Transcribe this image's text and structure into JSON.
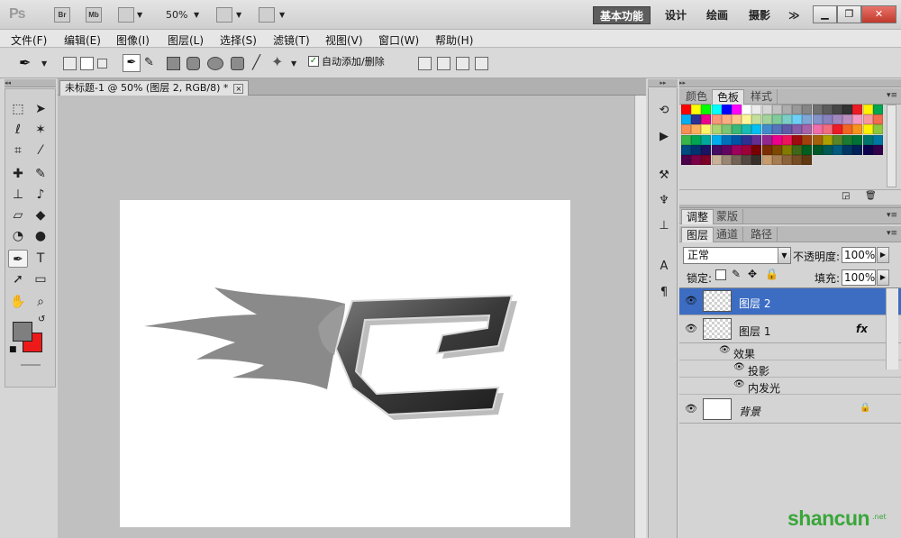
{
  "app": {
    "logo": "Ps",
    "bridge_btn": "Br",
    "minibridge_btn": "Mb",
    "zoom": "50%",
    "workspaces": [
      "基本功能",
      "设计",
      "绘画",
      "摄影"
    ],
    "more_label": "≫"
  },
  "menu": [
    "文件(F)",
    "编辑(E)",
    "图像(I)",
    "图层(L)",
    "选择(S)",
    "滤镜(T)",
    "视图(V)",
    "窗口(W)",
    "帮助(H)"
  ],
  "options": {
    "auto_add_delete": "自动添加/删除",
    "auto_add_checked": "✓"
  },
  "document": {
    "tab_title": "未标题-1 @ 50% (图层 2, RGB/8) *",
    "close": "×",
    "canvas_bg": "#ffffff",
    "fg_color": "#7f7f7f",
    "bg_color": "#ee1a1a"
  },
  "swatches_panel": {
    "tabs": [
      "颜色",
      "色板",
      "样式"
    ],
    "active_tab": "色板",
    "colors": [
      "#ff0000",
      "#ffff00",
      "#00ff00",
      "#00ffff",
      "#0000ff",
      "#ff00ff",
      "#ffffff",
      "#ebebeb",
      "#d6d6d6",
      "#c2c2c2",
      "#adadad",
      "#999999",
      "#858585",
      "#707070",
      "#5c5c5c",
      "#474747",
      "#333333",
      "#ed1c24",
      "#fff200",
      "#00a651",
      "#00aeef",
      "#2e3192",
      "#ec008c",
      "#f7977a",
      "#f9ad81",
      "#fdc68a",
      "#fff79a",
      "#c4df9b",
      "#a2d39c",
      "#82ca9d",
      "#7bcdc8",
      "#6ecff6",
      "#7ea7d8",
      "#8493ca",
      "#8882be",
      "#a187be",
      "#bc8dbf",
      "#f49ac2",
      "#f6989d",
      "#f26c4f",
      "#f68e55",
      "#fbaf5c",
      "#fff467",
      "#acd372",
      "#7cc576",
      "#3bb878",
      "#1abbb4",
      "#00bff3",
      "#438ccb",
      "#5574b9",
      "#605ca8",
      "#855fa8",
      "#a763a8",
      "#f06ea9",
      "#f26d7d",
      "#ed1c24",
      "#f26522",
      "#f7941d",
      "#fff200",
      "#8dc73f",
      "#39b54a",
      "#00a651",
      "#00a99d",
      "#00aeef",
      "#0072bc",
      "#0054a6",
      "#2e3192",
      "#662d91",
      "#92278f",
      "#ec008c",
      "#ed145b",
      "#9e0b0f",
      "#a0410d",
      "#a36209",
      "#aba000",
      "#598527",
      "#1a7b30",
      "#007236",
      "#00746b",
      "#0076a3",
      "#004b80",
      "#003471",
      "#1b1464",
      "#440e62",
      "#630460",
      "#9e005d",
      "#9e0039",
      "#790000",
      "#7b2e00",
      "#7d4900",
      "#827b00",
      "#406618",
      "#005e20",
      "#005826",
      "#005952",
      "#005b7f",
      "#003663",
      "#002157",
      "#0d004c",
      "#32004b",
      "#4b0049",
      "#7b0046",
      "#7a0026",
      "#c7b299",
      "#998675",
      "#736357",
      "#534741",
      "#37302a",
      "#c69c6d",
      "#a67c52",
      "#8c6239",
      "#754c24",
      "#603913"
    ]
  },
  "adjust_panel": {
    "tabs": [
      "调整",
      "蒙版"
    ],
    "active_tab": "调整"
  },
  "layers_panel": {
    "tabs": [
      "图层",
      "通道",
      "路径"
    ],
    "active_tab": "图层",
    "blend_mode": "正常",
    "opacity_label": "不透明度:",
    "opacity_value": "100%",
    "lock_label": "锁定:",
    "fill_label": "填充:",
    "fill_value": "100%",
    "layers": [
      {
        "name": "图层 2",
        "selected": true
      },
      {
        "name": "图层 1",
        "selected": false,
        "fx": "fx"
      },
      {
        "name": "背景",
        "selected": false
      }
    ],
    "effects_label": "效果",
    "effects": [
      "投影",
      "内发光"
    ]
  },
  "watermark": {
    "text": "shancun",
    "sub": ".net"
  }
}
